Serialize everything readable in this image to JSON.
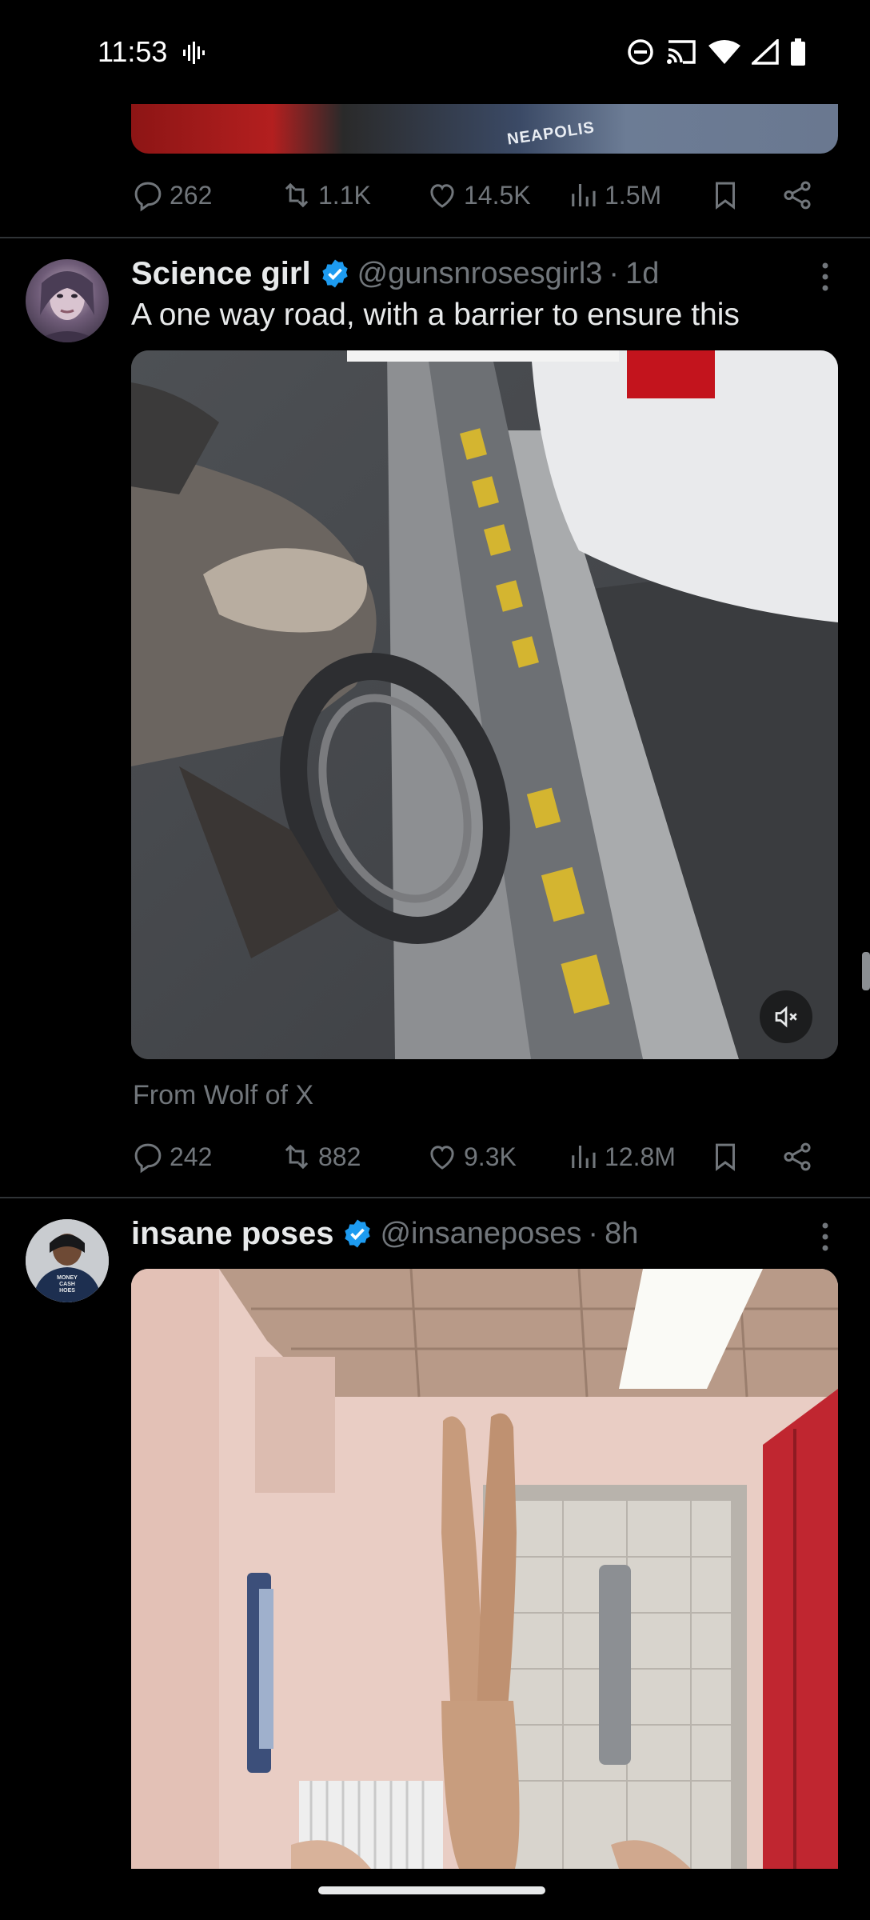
{
  "status_bar": {
    "time": "11:53",
    "icons": [
      "soundwave-icon",
      "do-not-disturb-icon",
      "cast-icon",
      "wifi-icon",
      "signal-icon",
      "battery-icon"
    ]
  },
  "top_tweet": {
    "media_text": "NEAPOLIS",
    "actions": {
      "replies": "262",
      "reposts": "1.1K",
      "likes": "14.5K",
      "views": "1.5M"
    }
  },
  "tweets": [
    {
      "author_name": "Science girl",
      "handle": "@gunsnrosesgirl3",
      "separator": "·",
      "time": "1d",
      "text": "A one way road, with a barrier to ensure this",
      "source": "From Wolf of X",
      "actions": {
        "replies": "242",
        "reposts": "882",
        "likes": "9.3K",
        "views": "12.8M"
      }
    },
    {
      "author_name": "insane poses",
      "handle": "@insaneposes",
      "separator": "·",
      "time": "8h",
      "avatar_text": "MONEY CASH HOES"
    }
  ],
  "colors": {
    "background": "#000000",
    "text_primary": "#e7e9ea",
    "text_secondary": "#71767b",
    "divider": "#2f3336",
    "verified": "#1d9bf0"
  }
}
